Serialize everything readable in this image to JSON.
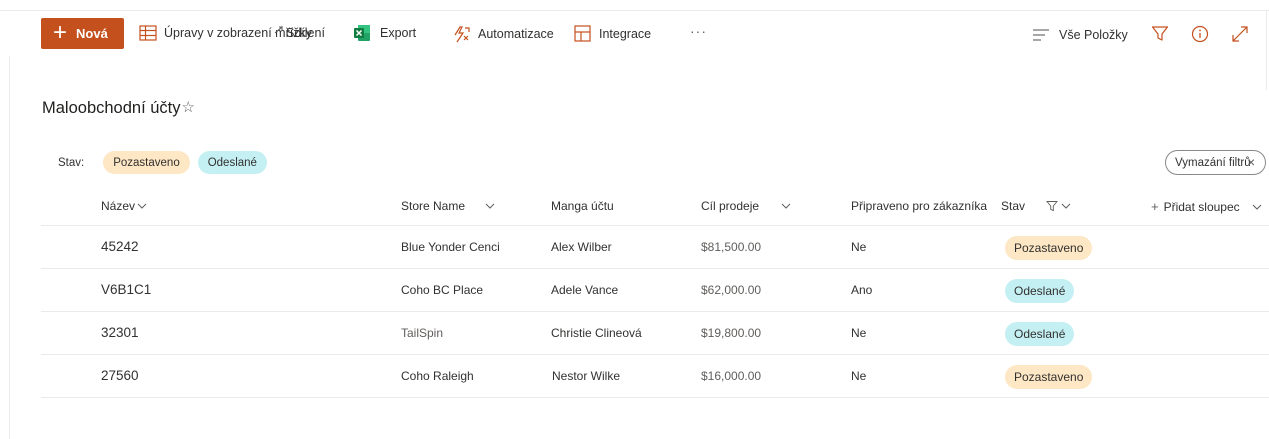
{
  "toolbar": {
    "new_label": "Nová",
    "grid_label": "Úpravy v zobrazení mřížky",
    "share_label": "Sdílení",
    "export_label": "Export",
    "automate_label": "Automatizace",
    "integrate_label": "Integrace",
    "more_label": "···",
    "view_label": "Vše Položky"
  },
  "list": {
    "title": "Maloobchodní účty",
    "star": "☆"
  },
  "filters": {
    "label": "Stav:",
    "pills": [
      "Pozastaveno",
      "Odeslané"
    ],
    "clear_label": "Vymazání filtrů",
    "clear_icon": "×"
  },
  "table": {
    "headers": {
      "name": "Název",
      "store": "Store Name",
      "manager": "Manga účtu",
      "target": "Cíl prodeje",
      "ready": "Připraveno pro zákazníka",
      "status": "Stav",
      "add": "Přidat sloupec"
    },
    "rows": [
      {
        "name": "45242",
        "store": "Blue Yonder Cenci",
        "manager": "Alex Wilber",
        "target": "$81,500.00",
        "ready": "Ne",
        "status": "Pozastaveno",
        "status_color": "#fde7c4"
      },
      {
        "name": "V6B1C1",
        "store": "Coho BC Place",
        "manager": "Adele Vance",
        "target": "$62,000.00",
        "ready": "Ano",
        "status": "Odeslané",
        "status_color": "#c5f0f3"
      },
      {
        "name": "32301",
        "store": "TailSpin",
        "manager": "Christie Clineová",
        "target": "$19,800.00",
        "ready": "Ne",
        "status": "Odeslané",
        "status_color": "#c5f0f3"
      },
      {
        "name": "27560",
        "store": "Coho Raleigh",
        "manager": "Nestor Wilke",
        "target": "$16,000.00",
        "ready": "Ne",
        "status": "Pozastaveno",
        "status_color": "#fde7c4"
      }
    ]
  },
  "colors": {
    "accent": "#c4501d",
    "paused": "#fde7c4",
    "sent": "#c5f0f3"
  },
  "icons": {
    "new": "plus-icon",
    "grid": "grid-icon",
    "share": "share-icon",
    "export": "excel-icon",
    "automate": "automate-icon",
    "integrate": "integration-icon",
    "view": "view-options-icon",
    "filter": "filter-icon",
    "info": "info-icon",
    "expand": "expand-icon"
  }
}
